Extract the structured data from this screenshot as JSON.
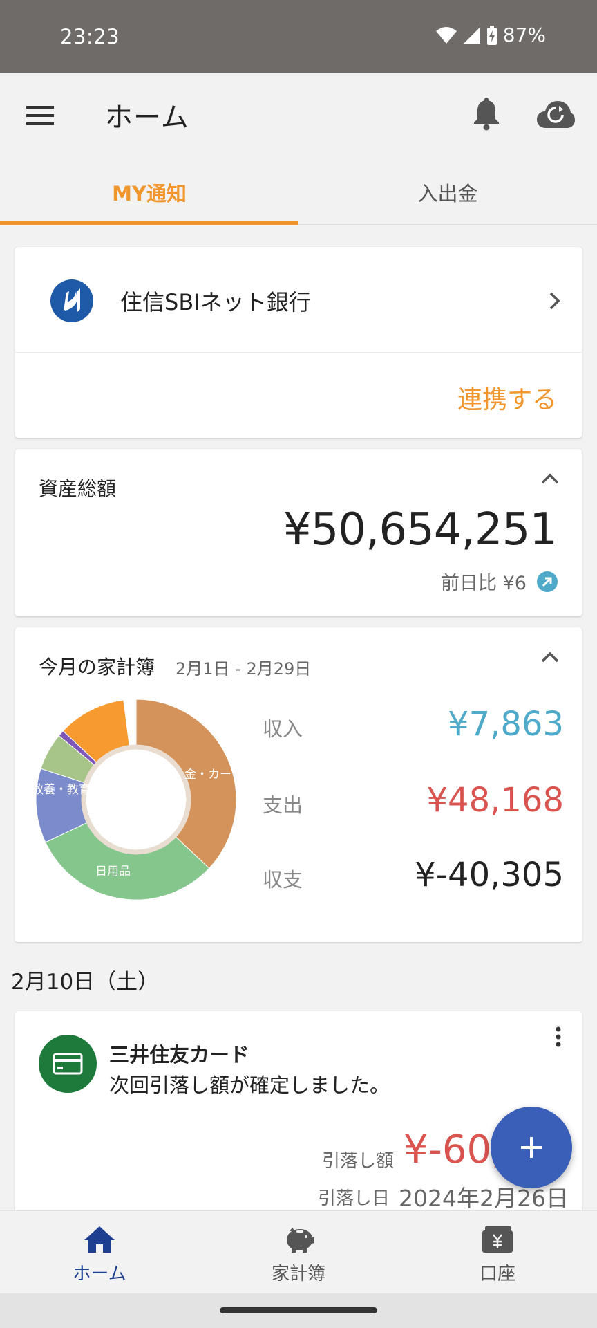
{
  "status_bar": {
    "time": "23:23",
    "battery": "87%"
  },
  "app_bar": {
    "title": "ホーム"
  },
  "tabs": [
    {
      "label": "MY通知",
      "active": true
    },
    {
      "label": "入出金",
      "active": false
    }
  ],
  "bank_card": {
    "name": "住信SBIネット銀行",
    "link_label": "連携する"
  },
  "asset_card": {
    "label": "資産総額",
    "amount": "¥50,654,251",
    "diff": "前日比 ¥6"
  },
  "budget_card": {
    "title": "今月の家計簿",
    "period": "2月1日 - 2月29日",
    "income_label": "収入",
    "income_value": "¥7,863",
    "expense_label": "支出",
    "expense_value": "¥48,168",
    "balance_label": "収支",
    "balance_value": "¥-40,305",
    "segments": [
      {
        "label": "金・カー",
        "fraction": 0.37,
        "color": "#d4935a"
      },
      {
        "label": "日用品",
        "fraction": 0.31,
        "color": "#85c68c"
      },
      {
        "label": "教養・教育",
        "fraction": 0.12,
        "color": "#7b8bcc"
      },
      {
        "label": "",
        "fraction": 0.06,
        "color": "#a8c589"
      },
      {
        "label": "",
        "fraction": 0.01,
        "color": "#7f57b8"
      },
      {
        "label": "",
        "fraction": 0.11,
        "color": "#f79a2f"
      }
    ]
  },
  "date_header": "2月10日（土）",
  "notice": {
    "title": "三井住友カード",
    "message": "次回引落し額が確定しました。",
    "debit_label": "引落し額",
    "debit_amount": "¥-60,",
    "debit_date_label": "引落し日",
    "debit_date": "2024年2月26日"
  },
  "bottom_nav": [
    {
      "label": "ホーム",
      "active": true
    },
    {
      "label": "家計簿",
      "active": false
    },
    {
      "label": "口座",
      "active": false
    }
  ],
  "colors": {
    "accent": "#f0962d",
    "income": "#4fa9c9",
    "expense": "#d9534f",
    "fab": "#3a5fb8",
    "nav_active": "#1e3f8f"
  }
}
